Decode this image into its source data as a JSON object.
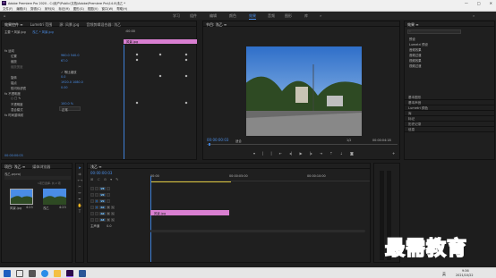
{
  "titlebar": {
    "title": "Adobe Premiere Pro 2020 - C:\\用户\\Public\\文档\\Adobe\\Premiere Pro\\14.0\\浅乙 *",
    "minimize": "—",
    "maximize": "□",
    "close": "✕"
  },
  "menu": [
    "文件(F)",
    "编辑(E)",
    "剪辑(C)",
    "序列(S)",
    "标记(M)",
    "图形(G)",
    "视图(V)",
    "窗口(W)",
    "帮助(H)"
  ],
  "workspaces": [
    "学习",
    "组件",
    "编辑",
    "颜色",
    "效果",
    "音频",
    "图形",
    "库"
  ],
  "active_workspace": "效果",
  "effect_controls": {
    "tabs": [
      "效果控件 ≡",
      "Lumetri 范围",
      "源: 风景.jpg",
      "音频剪辑混合器: 浅乙"
    ],
    "master": "主要 * 风景.jpg",
    "clip": "浅乙 * 风景.jpg",
    "timecode_head": ":00:00",
    "clip_name": "风景.jpg",
    "props": [
      {
        "name": "fx 运动",
        "value": ""
      },
      {
        "name": "位置",
        "value": "960.0  540.0"
      },
      {
        "name": "缩放",
        "value": "67.0"
      },
      {
        "name": "缩放宽度",
        "value": ""
      },
      {
        "name": "等比缩放",
        "value": "✓ 等比缩放"
      },
      {
        "name": "旋转",
        "value": "0.0"
      },
      {
        "name": "锚点",
        "value": "1920.0  1080.0"
      },
      {
        "name": "防闪烁滤镜",
        "value": "0.00"
      },
      {
        "name": "fx 不透明度",
        "value": ""
      },
      {
        "name": "○ □ ✎",
        "value": ""
      },
      {
        "name": "不透明度",
        "value": "100.0 %"
      },
      {
        "name": "混合模式",
        "value": "正常"
      },
      {
        "name": "fx 时间重映射",
        "value": ""
      }
    ],
    "footer_time": "00:00:00:03"
  },
  "program": {
    "tab": "节目: 浅乙 ≡",
    "timecode": "00:00:00:03",
    "fit": "适合",
    "ratio": "1/2",
    "duration": "00:00:04:18"
  },
  "effects_panel": {
    "title": "效果 ≡",
    "items": [
      "预设",
      "Lumetri 预设",
      "音频效果",
      "音频过渡",
      "视频效果",
      "视频过渡"
    ],
    "sections": [
      "基本图形",
      "基本声音",
      "Lumetri 颜色",
      "库",
      "标记",
      "历史记录",
      "信息"
    ]
  },
  "project": {
    "tabs": [
      "项目: 浅乙 ≡",
      "媒体浏览器"
    ],
    "name": "浅乙.prproj",
    "count": "1项已选择, 共 2 项",
    "items": [
      {
        "name": "风景.jpg",
        "dur": "4:23"
      },
      {
        "name": "浅乙",
        "dur": "4:23"
      }
    ]
  },
  "timeline": {
    "tab": "浅乙 ≡",
    "timecode": "00:00:00:03",
    "ruler": [
      "00:00",
      "00:00:05:00",
      "00:00:10:00"
    ],
    "tracks": [
      "V3",
      "V2",
      "V1",
      "A1",
      "A2",
      "A3",
      "主声道"
    ],
    "master_value": "0.0",
    "clip_label": "风景.jpg"
  },
  "watermark": "最需教育",
  "taskbar": {
    "time": "9:36",
    "date": "2021/10/22",
    "lang": "英"
  },
  "colors": {
    "accent": "#4a8de6",
    "clip": "#d97fd1",
    "playhead": "#3e7fd6"
  }
}
